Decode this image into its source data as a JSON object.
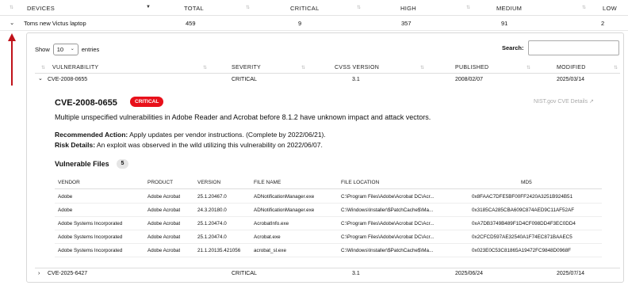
{
  "devices_table": {
    "headers": [
      "DEVICES",
      "TOTAL",
      "CRITICAL",
      "HIGH",
      "MEDIUM",
      "LOW"
    ],
    "row": {
      "device": "Toms new Victus laptop",
      "total": "459",
      "critical": "9",
      "high": "357",
      "medium": "91",
      "low": "2"
    }
  },
  "show_entries": {
    "show_label": "Show",
    "value": "10",
    "entries_label": "entries"
  },
  "search": {
    "label": "Search:",
    "placeholder": ""
  },
  "vuln_table": {
    "headers": [
      "VULNERABILITY",
      "SEVERITY",
      "CVSS VERSION",
      "PUBLISHED",
      "MODIFIED"
    ],
    "rows": [
      {
        "id": "CVE-2008-0655",
        "severity": "CRITICAL",
        "cvss": "3.1",
        "published": "2008/02/07",
        "modified": "2025/03/14"
      },
      {
        "id": "CVE-2025-6427",
        "severity": "CRITICAL",
        "cvss": "3.1",
        "published": "2025/06/24",
        "modified": "2025/07/14"
      }
    ]
  },
  "detail": {
    "title": "CVE-2008-0655",
    "badge": "CRITICAL",
    "nist_link": "NIST.gov CVE Details",
    "description": "Multiple unspecified vulnerabilities in Adobe Reader and Acrobat before 8.1.2 have unknown impact and attack vectors.",
    "recommended_label": "Recommended Action:",
    "recommended_text": " Apply updates per vendor instructions. (Complete by 2022/06/21).",
    "risk_label": "Risk Details:",
    "risk_text": " An exploit was observed in the wild utilizing this vulnerability on 2022/06/07.",
    "vulnerable_files_label": "Vulnerable Files",
    "vulnerable_files_count": "5"
  },
  "files_table": {
    "headers": [
      "VENDOR",
      "PRODUCT",
      "VERSION",
      "FILE NAME",
      "FILE LOCATION",
      "MD5"
    ],
    "rows": [
      {
        "vendor": "Adobe",
        "product": "Adobe Acrobat",
        "version": "25.1.20467.0",
        "file": "ADNotificationManager.exe",
        "location": "C:\\Program Files\\Adobe\\Acrobat DC\\Acr...",
        "md5": "0x8FAAC7DFE5BF00FF2420A3251B924B51"
      },
      {
        "vendor": "Adobe",
        "product": "Adobe Acrobat",
        "version": "24.3.20180.0",
        "file": "ADNotificationManager.exe",
        "location": "C:\\Windows\\Installer\\$PatchCache$\\Ma...",
        "md5": "0x3185CA285CBA609C874AED9C11AF52AF"
      },
      {
        "vendor": "Adobe Systems Incorporated",
        "product": "Adobe Acrobat",
        "version": "25.1.20474.0",
        "file": "AcrobatInfo.exe",
        "location": "C:\\Program Files\\Adobe\\Acrobat DC\\Acr...",
        "md5": "0xA7DB3749B489F1D4CF098DD4F3EC0DD4"
      },
      {
        "vendor": "Adobe Systems Incorporated",
        "product": "Adobe Acrobat",
        "version": "25.1.20474.0",
        "file": "Acrobat.exe",
        "location": "C:\\Program Files\\Adobe\\Acrobat DC\\Acr...",
        "md5": "0x2CFCD597AE32540A1F74EC871BAAEC5"
      },
      {
        "vendor": "Adobe Systems Incorporated",
        "product": "Adobe Acrobat",
        "version": "21.1.20135.421056",
        "file": "acrobat_sl.exe",
        "location": "C:\\Windows\\Installer\\$PatchCache$\\Ma...",
        "md5": "0x023E0C53C81865A19472FC9848D0968F"
      }
    ]
  },
  "colors": {
    "critical_badge": "#e8101a",
    "annotation_arrow": "#c0121a"
  },
  "icons": {
    "expand": "chevron-down-icon",
    "collapse": "chevron-right-icon",
    "external": "external-link-icon",
    "sort": "sort-icon"
  }
}
